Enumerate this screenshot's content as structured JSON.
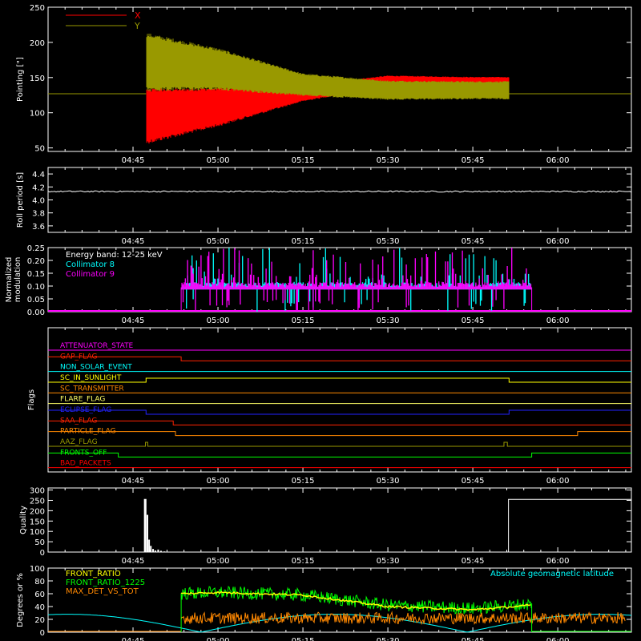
{
  "time_axis": {
    "tick_labels": [
      "04:45",
      "05:00",
      "05:15",
      "05:30",
      "05:45",
      "06:00"
    ],
    "tick_minutes": [
      285,
      300,
      315,
      330,
      345,
      360
    ],
    "range_minutes": [
      270,
      373
    ]
  },
  "chart_data": [
    {
      "type": "line",
      "panel": "pointing",
      "ylabel": "Pointing [\"]",
      "ylim": [
        45,
        250
      ],
      "yticks": [
        50,
        100,
        150,
        200,
        250
      ],
      "legend_placement": "top-left",
      "reference_line": 127,
      "data_window_minutes": [
        287.3,
        351.4
      ],
      "series": [
        {
          "name": "X",
          "color": "#ff0000",
          "center": [
            [
              287.3,
              95
            ],
            [
              300,
              108
            ],
            [
              315,
              128
            ],
            [
              330,
              145
            ],
            [
              345,
              145
            ],
            [
              351.4,
              145
            ]
          ],
          "amplitude": [
            [
              287.3,
              40
            ],
            [
              300,
              28
            ],
            [
              315,
              12
            ],
            [
              330,
              8
            ],
            [
              345,
              6
            ],
            [
              351.4,
              6
            ]
          ]
        },
        {
          "name": "Y",
          "color": "#999900",
          "center": [
            [
              287.3,
              172
            ],
            [
              300,
              162
            ],
            [
              315,
              140
            ],
            [
              330,
              132
            ],
            [
              345,
              132
            ],
            [
              351.4,
              132
            ]
          ],
          "amplitude": [
            [
              287.3,
              42
            ],
            [
              300,
              30
            ],
            [
              315,
              16
            ],
            [
              330,
              14
            ],
            [
              345,
              13
            ],
            [
              351.4,
              13
            ]
          ]
        }
      ]
    },
    {
      "type": "line",
      "panel": "roll",
      "ylabel": "Roll period [s]",
      "ylim": [
        3.5,
        4.5
      ],
      "yticks": [
        3.6,
        3.8,
        4.0,
        4.2,
        4.4
      ],
      "series": [
        {
          "color": "#ffffff",
          "value": 4.13
        }
      ]
    },
    {
      "type": "bar",
      "panel": "modulation",
      "ylabel": [
        "Normalized",
        "modulation"
      ],
      "ylim": [
        0,
        0.25
      ],
      "yticks": [
        0.0,
        0.05,
        0.1,
        0.15,
        0.2,
        0.25
      ],
      "ytick_labels": [
        "0.00",
        "0.05",
        "0.10",
        "0.15",
        "0.20",
        "0.25"
      ],
      "annotation": "Energy band: 12-25 keV",
      "data_window_minutes": [
        293.5,
        355.4
      ],
      "baseline": 0.095,
      "series": [
        {
          "name": "Collimator 8",
          "color": "#00ffff"
        },
        {
          "name": "Collimator 9",
          "color": "#ff00ff"
        }
      ]
    },
    {
      "type": "line",
      "panel": "flags",
      "ylabel": "Flags",
      "flags": [
        {
          "name": "ATTENUATOR_STATE",
          "color": "#ff00ff",
          "steps": [
            [
              270,
              0
            ]
          ]
        },
        {
          "name": "GAP_FLAG",
          "color": "#ff2200",
          "steps": [
            [
              270,
              1
            ],
            [
              293.5,
              0
            ]
          ]
        },
        {
          "name": "NON_SOLAR_EVENT",
          "color": "#00ffff",
          "steps": [
            [
              270,
              0
            ]
          ]
        },
        {
          "name": "SC_IN_SUNLIGHT",
          "color": "#ffff00",
          "steps": [
            [
              270,
              0
            ],
            [
              287.3,
              1
            ],
            [
              351.4,
              0
            ]
          ]
        },
        {
          "name": "SC_TRANSMITTER",
          "color": "#ff8800",
          "steps": [
            [
              270,
              0
            ]
          ]
        },
        {
          "name": "FLARE_FLAG",
          "color": "#ffff66",
          "steps": [
            [
              270,
              0
            ]
          ]
        },
        {
          "name": "ECLIPSE_FLAG",
          "color": "#2222ff",
          "steps": [
            [
              270,
              1
            ],
            [
              287.3,
              0
            ],
            [
              351.4,
              1
            ]
          ]
        },
        {
          "name": "SAA_FLAG",
          "color": "#ff2200",
          "steps": [
            [
              270,
              1
            ],
            [
              292.1,
              0
            ]
          ]
        },
        {
          "name": "PARTICLE_FLAG",
          "color": "#ff8800",
          "steps": [
            [
              270,
              1
            ],
            [
              292.5,
              0
            ],
            [
              363.5,
              1
            ]
          ]
        },
        {
          "name": "AAZ_FLAG",
          "color": "#999900",
          "steps": [
            [
              270,
              0
            ],
            [
              287.2,
              1
            ],
            [
              287.6,
              0
            ],
            [
              350.5,
              1
            ],
            [
              351.1,
              0
            ]
          ]
        },
        {
          "name": "FRONTS_OFF",
          "color": "#00ff00",
          "steps": [
            [
              270,
              1
            ],
            [
              282.4,
              0
            ],
            [
              355.4,
              1
            ]
          ]
        },
        {
          "name": "BAD_PACKETS",
          "color": "#ff0000",
          "steps": [
            [
              270,
              0
            ]
          ]
        }
      ]
    },
    {
      "type": "bar",
      "panel": "quality",
      "ylabel": "Quality",
      "ylim": [
        0,
        310
      ],
      "yticks": [
        0,
        50,
        100,
        150,
        200,
        250,
        300
      ],
      "segments": [
        {
          "x": [
            287.0,
            287.3
          ],
          "value": 255
        },
        {
          "x": [
            351.3,
            373
          ],
          "value": 255
        }
      ],
      "decay_points": [
        [
          287.4,
          180
        ],
        [
          287.7,
          60
        ],
        [
          288.0,
          30
        ],
        [
          288.4,
          15
        ],
        [
          288.8,
          8
        ],
        [
          289.3,
          12
        ],
        [
          289.8,
          6
        ],
        [
          290.4,
          3
        ]
      ]
    },
    {
      "type": "line",
      "panel": "ratios",
      "ylabel": "Degrees or %",
      "ylim": [
        0,
        100
      ],
      "yticks": [
        0,
        20,
        40,
        60,
        80,
        100
      ],
      "annotation": "Absolute geomagnetic latitude",
      "annotation_color": "#00ffff",
      "series": [
        {
          "name": "FRONT_RATIO",
          "color": "#ffff00",
          "trend": [
            [
              293.5,
              60
            ],
            [
              300,
              62
            ],
            [
              315,
              58
            ],
            [
              330,
              40
            ],
            [
              345,
              35
            ],
            [
              355.4,
              42
            ]
          ]
        },
        {
          "name": "FRONT_RATIO_1225",
          "color": "#00ff00",
          "trend": [
            [
              293.5,
              60
            ],
            [
              300,
              62
            ],
            [
              315,
              58
            ],
            [
              330,
              42
            ],
            [
              345,
              37
            ],
            [
              355.4,
              44
            ]
          ],
          "noise": 10
        },
        {
          "name": "MAX_DET_VS_TOT",
          "color": "#ff8800",
          "trend": [
            [
              293.5,
              22
            ],
            [
              372,
              22
            ]
          ],
          "noise": 9
        },
        {
          "name": "Absolute geomagnetic latitude",
          "color": "#00ffff",
          "period_minutes": 47,
          "amplitude": 28
        }
      ]
    }
  ]
}
